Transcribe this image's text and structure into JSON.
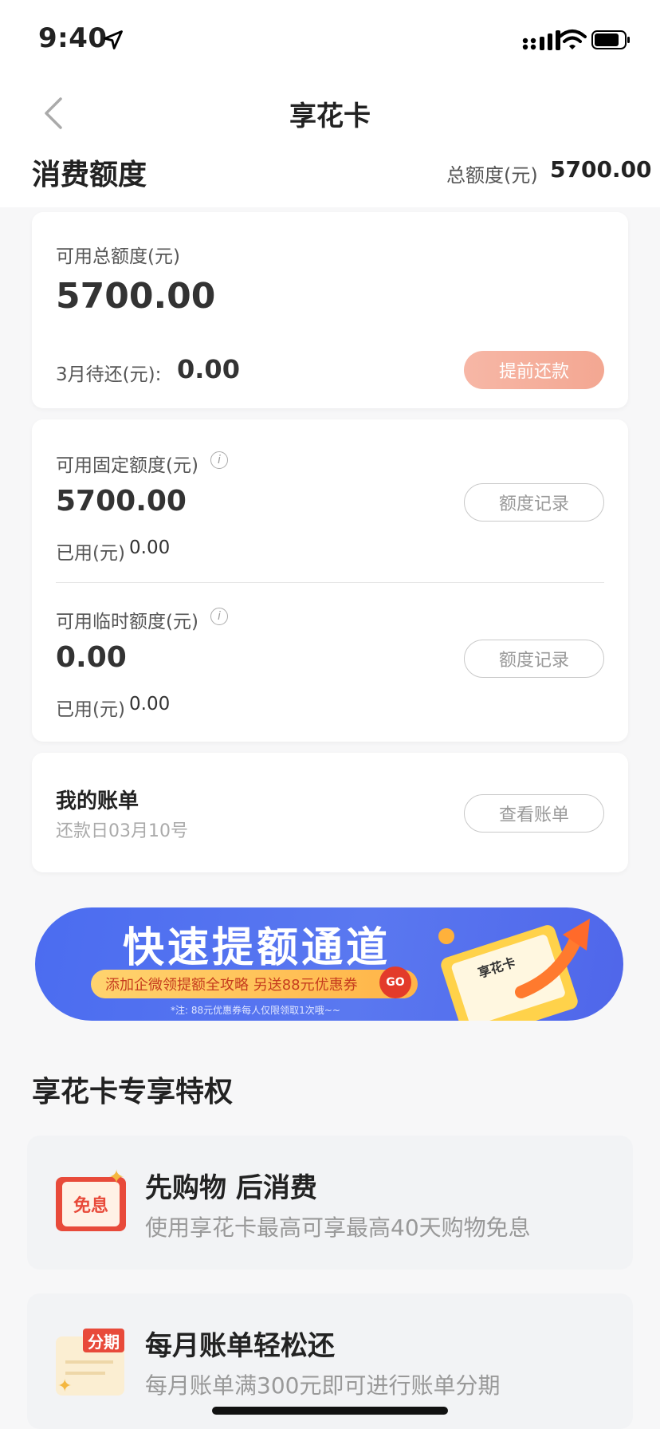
{
  "status_bar": {
    "time": "9:40"
  },
  "nav": {
    "title": "享花卡"
  },
  "header": {
    "title": "消费额度",
    "total_label": "总额度(元)",
    "total_value": "5700.00"
  },
  "available": {
    "label": "可用总额度(元)",
    "value": "5700.00",
    "due_label": "3月待还(元):",
    "due_value": "0.00",
    "repay_button": "提前还款"
  },
  "fixed": {
    "label": "可用固定额度(元)",
    "value": "5700.00",
    "used_label": "已用(元)",
    "used_value": "0.00",
    "record_button": "额度记录"
  },
  "temp": {
    "label": "可用临时额度(元)",
    "value": "0.00",
    "used_label": "已用(元)",
    "used_value": "0.00",
    "record_button": "额度记录"
  },
  "bill": {
    "title": "我的账单",
    "repay_day": "还款日03月10号",
    "view_button": "查看账单"
  },
  "banner": {
    "title": "快速提额通道",
    "strip": "添加企微领提额全攻略 另送88元优惠券",
    "go": "GO",
    "note": "*注: 88元优惠券每人仅限领取1次哦~~",
    "card_text": "享花卡"
  },
  "privileges": {
    "title": "享花卡专享特权",
    "items": [
      {
        "icon_text": "免息",
        "title": "先购物 后消费",
        "desc": "使用享花卡最高可享最高40天购物免息"
      },
      {
        "icon_text": "分期",
        "title": "每月账单轻松还",
        "desc": "每月账单满300元即可进行账单分期"
      }
    ]
  },
  "colors": {
    "accent": "#f3a792",
    "banner": "#4b6cf0",
    "badge_red": "#e84a3a"
  }
}
